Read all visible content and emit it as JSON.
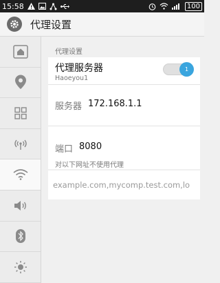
{
  "status_bar": {
    "time": "15:58",
    "battery": "100"
  },
  "header": {
    "title": "代理设置"
  },
  "sidebar": {
    "items": [
      {
        "icon": "home-icon"
      },
      {
        "icon": "location-icon"
      },
      {
        "icon": "apps-grid-icon"
      },
      {
        "icon": "antenna-icon"
      },
      {
        "icon": "wifi-icon",
        "active": true
      },
      {
        "icon": "volume-icon"
      },
      {
        "icon": "bluetooth-icon"
      },
      {
        "icon": "brightness-icon"
      }
    ]
  },
  "main": {
    "section_label": "代理设置",
    "proxy": {
      "title": "代理服务器",
      "subtitle": "Haoeyou1",
      "toggle_value": "1"
    },
    "server": {
      "label": "服务器",
      "value": "172.168.1.1"
    },
    "port": {
      "label": "端口",
      "value": "8080"
    },
    "bypass_label": "对以下网址不使用代理",
    "bypass_value": "example.com,mycomp.test.com,lo"
  },
  "colors": {
    "accent": "#3aa5de",
    "status_bar": "#1e1e1e"
  }
}
